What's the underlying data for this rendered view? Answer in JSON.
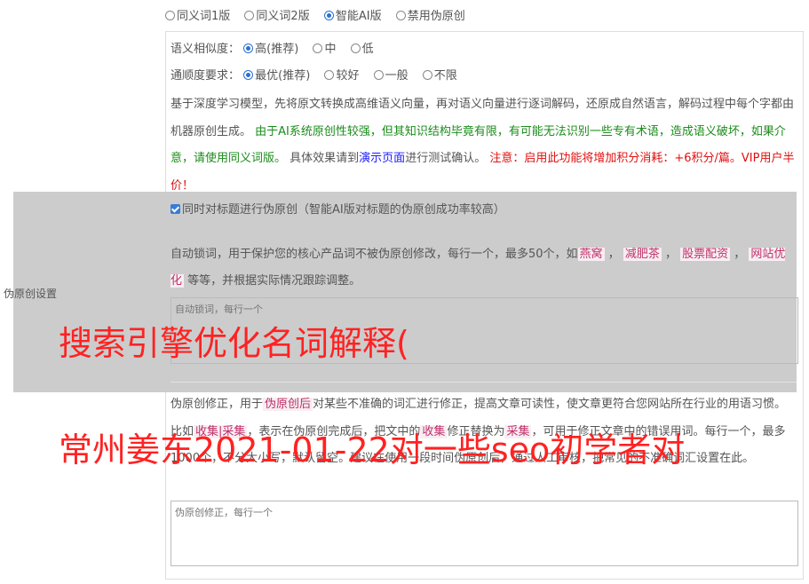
{
  "modes": [
    {
      "label": "同义词1版",
      "selected": false
    },
    {
      "label": "同义词2版",
      "selected": false
    },
    {
      "label": "智能AI版",
      "selected": true
    },
    {
      "label": "禁用伪原创",
      "selected": false
    }
  ],
  "similarity": {
    "label": "语义相似度：",
    "options": [
      {
        "label": "高(推荐)",
        "selected": true
      },
      {
        "label": "中",
        "selected": false
      },
      {
        "label": "低",
        "selected": false
      }
    ]
  },
  "fluency": {
    "label": "通顺度要求：",
    "options": [
      {
        "label": "最优(推荐)",
        "selected": true
      },
      {
        "label": "较好",
        "selected": false
      },
      {
        "label": "一般",
        "selected": false
      },
      {
        "label": "不限",
        "selected": false
      }
    ]
  },
  "description": {
    "part1": "基于深度学习模型，先将原文转换成高维语义向量，再对语义向量进行逐词解码，还原成自然语言，解码过程中每个字都由机器原创生成。",
    "part2_green": "由于AI系统原创性较强，但其知识结构毕竟有限，有可能无法识别一些专有术语，造成语义破坏，如果介意，请使用同义词版。",
    "part3": "具体效果请到",
    "demo_link": "演示页面",
    "part4": "进行测试确认。",
    "part5_red": "注意：启用此功能将增加积分消耗：+6积分/篇。VIP用户半价！"
  },
  "title_checkbox": {
    "label": "同时对标题进行伪原创（智能AI版对标题的伪原创成功率较高）",
    "checked": true
  },
  "section_label": "伪原创设置",
  "lock_words": {
    "desc_before": "自动锁词，用于保护您的核心产品词不被伪原创修改，每行一个，最多50个，如",
    "examples": [
      "燕窝",
      "减肥茶",
      "股票配资",
      "网站优化"
    ],
    "desc_after": "等等，并根据实际情况跟踪调整。",
    "placeholder": "自动锁词，每行一个"
  },
  "correction": {
    "desc_a": "伪原创修正，用于",
    "tag1": "伪原创后",
    "desc_b": "对某些不准确的词汇进行修正，提高文章可读性，使文章更符合您网站所在行业的用语习惯。比如",
    "tag2": "收集|采集",
    "desc_c": "，表示在伪原创完成后，把文中的",
    "tag3": "收集",
    "desc_d": "修正替换为",
    "tag4": "采集",
    "desc_e": "，可用于修正文章中的错误用词。每行一个，最多1000个，不分大小写，默认留空。建议在使用一段时间伪原创后，通过人工审核，把常见的不准确词汇设置在此。",
    "placeholder": "伪原创修正，每行一个"
  },
  "overlay_text": {
    "line1": "搜索引擎优化名词解释(",
    "line2": "常州姜东2021-01-22对一些seo初学者对"
  }
}
